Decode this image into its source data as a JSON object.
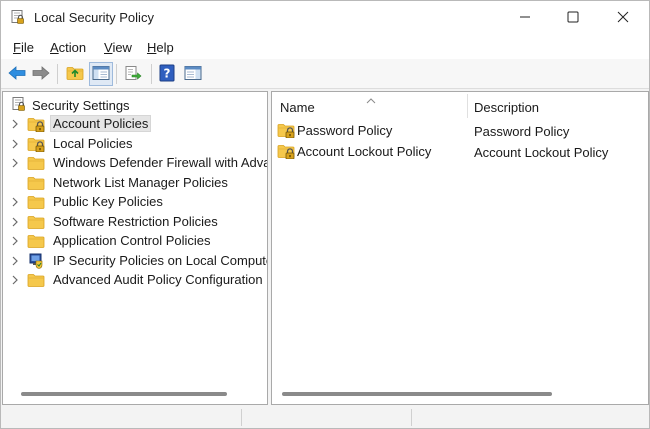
{
  "window": {
    "title": "Local Security Policy",
    "icon": "security-policy-icon",
    "buttons": [
      "minimize-icon",
      "maximize-icon",
      "close-icon"
    ]
  },
  "menu": {
    "file": "File",
    "action": "Action",
    "view": "View",
    "help": "Help"
  },
  "toolbar": {
    "icons": [
      "back-arrow-icon",
      "forward-arrow-icon",
      "up-folder-icon",
      "show-hide-console-tree-icon",
      "export-list-icon",
      "help-icon",
      "show-hide-action-pane-icon"
    ]
  },
  "tree": {
    "root": "Security Settings",
    "items": [
      {
        "label": "Account Policies",
        "expandable": true,
        "selected": true,
        "icon": "locked-folder-icon"
      },
      {
        "label": "Local Policies",
        "expandable": true,
        "selected": false,
        "icon": "locked-folder-icon"
      },
      {
        "label": "Windows Defender Firewall with Advanced Security",
        "expandable": true,
        "selected": false,
        "icon": "folder-icon"
      },
      {
        "label": "Network List Manager Policies",
        "expandable": false,
        "selected": false,
        "icon": "folder-icon"
      },
      {
        "label": "Public Key Policies",
        "expandable": true,
        "selected": false,
        "icon": "folder-icon"
      },
      {
        "label": "Software Restriction Policies",
        "expandable": true,
        "selected": false,
        "icon": "folder-icon"
      },
      {
        "label": "Application Control Policies",
        "expandable": true,
        "selected": false,
        "icon": "folder-icon"
      },
      {
        "label": "IP Security Policies on Local Computer",
        "expandable": true,
        "selected": false,
        "icon": "ip-security-icon"
      },
      {
        "label": "Advanced Audit Policy Configuration",
        "expandable": true,
        "selected": false,
        "icon": "folder-icon"
      }
    ]
  },
  "list": {
    "columns": {
      "name": "Name",
      "description": "Description"
    },
    "rows": [
      {
        "name": "Password Policy",
        "description": "Password Policy"
      },
      {
        "name": "Account Lockout Policy",
        "description": "Account Lockout Policy"
      }
    ]
  },
  "colors": {
    "folder": "#f5c84c",
    "folder_dark": "#e0a823",
    "back_arrow": "#2f8ee0",
    "help_icon": "#2f5fbf"
  }
}
